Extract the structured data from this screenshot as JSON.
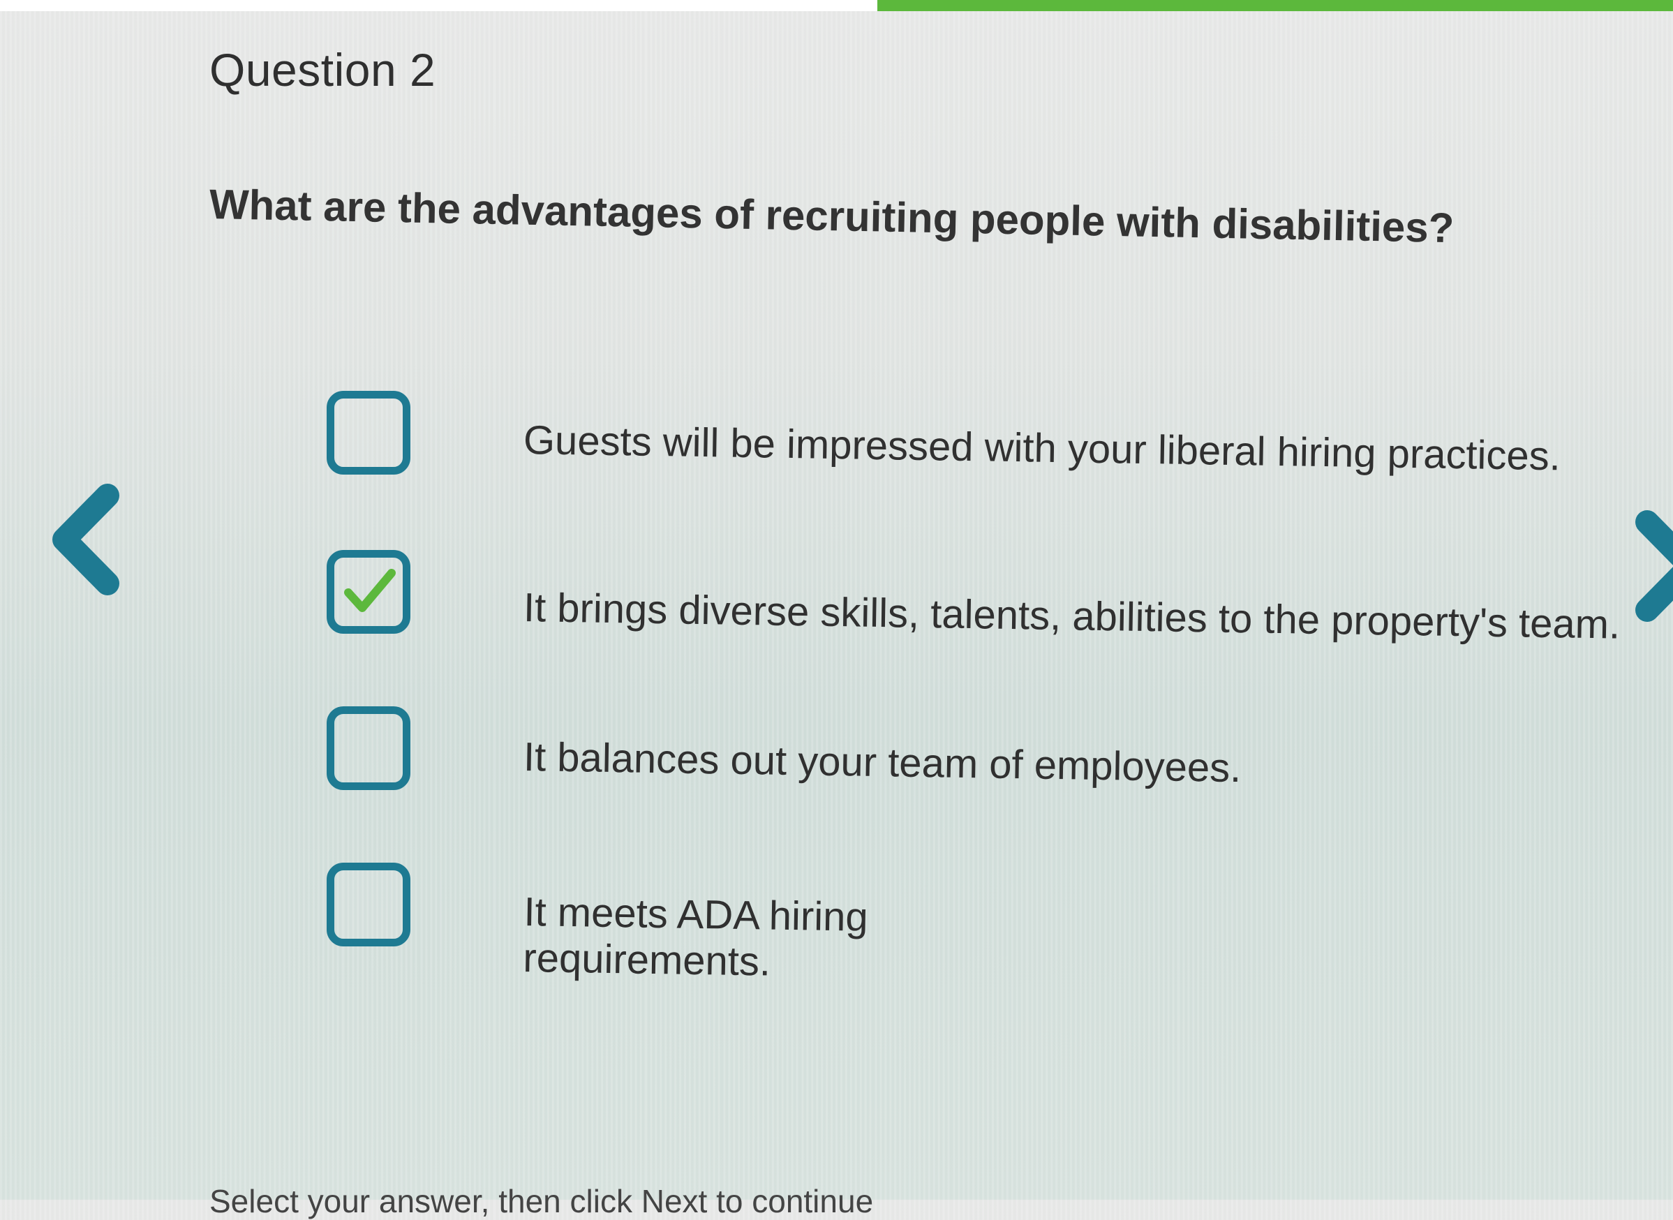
{
  "quiz": {
    "question_number": "Question 2",
    "question_text": "What are the advantages of recruiting people with disabilities?",
    "options": [
      {
        "label": "Guests will be impressed with your liberal hiring practices.",
        "checked": false
      },
      {
        "label": "It brings diverse skills, talents, abilities to the property's team.",
        "checked": true
      },
      {
        "label": "It balances out your team of employees.",
        "checked": false
      },
      {
        "label": "It meets ADA hiring requirements.",
        "checked": false
      }
    ]
  },
  "navigation": {
    "prev_icon": "chevron-left-icon",
    "next_icon": "chevron-right-icon"
  },
  "footer": {
    "hint": "Select your answer, then click Next to continue"
  },
  "colors": {
    "accent": "#1e7a92",
    "check": "#5cb83c",
    "progress": "#5cb83c"
  }
}
